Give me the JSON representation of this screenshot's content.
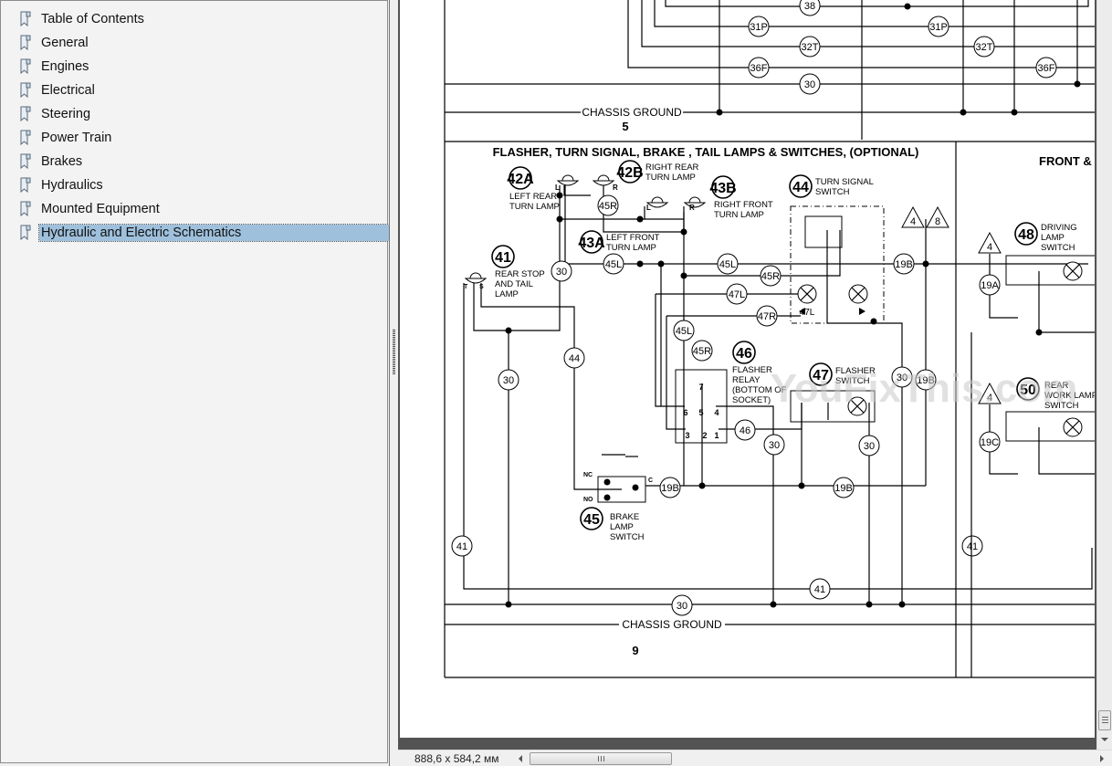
{
  "sidebar": {
    "bookmarks": [
      {
        "label": "Table of Contents",
        "icon": "bookmark-icon",
        "selected": false
      },
      {
        "label": "General",
        "icon": "bookmark-icon",
        "selected": false
      },
      {
        "label": "Engines",
        "icon": "bookmark-icon",
        "selected": false
      },
      {
        "label": "Electrical",
        "icon": "bookmark-icon",
        "selected": false
      },
      {
        "label": "Steering",
        "icon": "bookmark-icon",
        "selected": false
      },
      {
        "label": "Power Train",
        "icon": "bookmark-icon",
        "selected": false
      },
      {
        "label": "Brakes",
        "icon": "bookmark-icon",
        "selected": false
      },
      {
        "label": "Hydraulics",
        "icon": "bookmark-icon",
        "selected": false
      },
      {
        "label": "Mounted Equipment",
        "icon": "bookmark-icon",
        "selected": false
      },
      {
        "label": "Hydraulic and Electric Schematics",
        "icon": "bookmark-icon",
        "selected": true
      }
    ],
    "selected_color": "#9ec0dc"
  },
  "status": {
    "page_size": "888,6 x 584,2 мм"
  },
  "schematic": {
    "top_section": {
      "wire_labels": [
        "38",
        "31P",
        "31P",
        "32T",
        "32T",
        "36F",
        "36F",
        "30"
      ],
      "ground_label": "CHASSIS GROUND",
      "section_number": "5"
    },
    "main_section": {
      "title": "FLASHER, TURN SIGNAL, BRAKE , TAIL LAMPS & SWITCHES, (OPTIONAL)",
      "components": [
        {
          "id": "42A",
          "label": [
            "LEFT REAR",
            "TURN LAMP"
          ]
        },
        {
          "id": "42B",
          "label": [
            "RIGHT REAR",
            "TURN LAMP"
          ]
        },
        {
          "id": "43B",
          "label": [
            "RIGHT FRONT",
            "TURN LAMP"
          ]
        },
        {
          "id": "43A",
          "label": [
            "LEFT FRONT",
            "TURN LAMP"
          ]
        },
        {
          "id": "44",
          "label": [
            "TURN SIGNAL",
            "SWITCH"
          ]
        },
        {
          "id": "41",
          "label": [
            "REAR STOP",
            "AND TAIL",
            "LAMP"
          ]
        },
        {
          "id": "46",
          "label": [
            "FLASHER",
            "RELAY",
            "(BOTTOM OF",
            "SOCKET)"
          ]
        },
        {
          "id": "47",
          "label": [
            "FLASHER",
            "SWITCH"
          ]
        },
        {
          "id": "45",
          "label": [
            "BRAKE",
            "LAMP",
            "SWITCH"
          ]
        }
      ],
      "wires": [
        "45R",
        "30",
        "45L",
        "45L",
        "45R",
        "47L",
        "47R",
        "19B",
        "45L",
        "45R",
        "44",
        "30",
        "46",
        "30",
        "30",
        "30",
        "19B",
        "19B",
        "19B",
        "41",
        "41",
        "41",
        "30"
      ],
      "triangles": [
        "4",
        "8"
      ],
      "relay_pins": [
        "7",
        "6",
        "5",
        "4",
        "3",
        "2",
        "1"
      ],
      "switch_terminals": [
        "NC",
        "NO",
        "C"
      ],
      "lamp_terminals": [
        "L",
        "R",
        "L",
        "R",
        "T",
        "S"
      ],
      "ground_label": "CHASSIS GROUND",
      "section_number": "9"
    },
    "right_section": {
      "title": "FRONT &",
      "components": [
        {
          "id": "48",
          "label": [
            "DRIVING",
            "LAMP",
            "SWITCH"
          ]
        },
        {
          "id": "50",
          "label": [
            "REAR",
            "WORK LAMP",
            "SWITCH"
          ]
        }
      ],
      "wires": [
        "19A",
        "19C",
        "41"
      ],
      "triangles": [
        "4",
        "4"
      ]
    },
    "watermark": "YouFixThis.com"
  }
}
